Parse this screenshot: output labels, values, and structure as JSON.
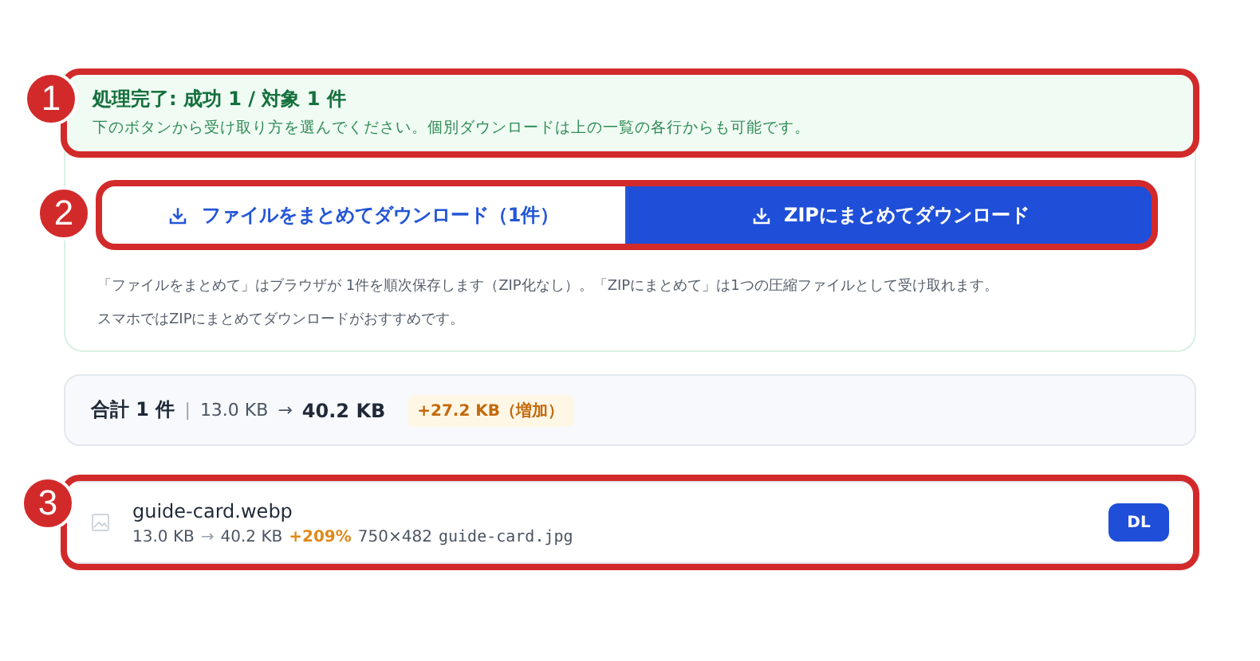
{
  "status": {
    "title": "処理完了: 成功 1 / 対象 1 件",
    "message": "下のボタンから受け取り方を選んでください。個別ダウンロードは上の一覧の各行からも可能です。",
    "callout": "1"
  },
  "button_row": {
    "callout": "2",
    "buttons": [
      {
        "label": "ファイルをまとめてダウンロード（1件）",
        "kind": "outline"
      },
      {
        "label": "ZIPにまとめてダウンロード",
        "kind": "primary"
      }
    ]
  },
  "notes": [
    "「ファイルをまとめて」はブラウザが 1件を順次保存します（ZIP化なし）。「ZIPにまとめて」は1つの圧縮ファイルとして受け取れます。",
    "スマホではZIPにまとめてダウンロードがおすすめです。"
  ],
  "summary": {
    "label": "合計 1 件",
    "separator": "|",
    "from": "13.0 KB",
    "arrow": "→",
    "to": "40.2 KB",
    "delta": "+27.2 KB（増加）"
  },
  "files": [
    {
      "name": "guide-card.webp",
      "from": "13.0 KB",
      "arrow": "→",
      "to": "40.2 KB",
      "change": "+209%",
      "dimensions": "750×482",
      "output": "guide-card.jpg",
      "action": "DL",
      "callout": "3"
    }
  ]
}
